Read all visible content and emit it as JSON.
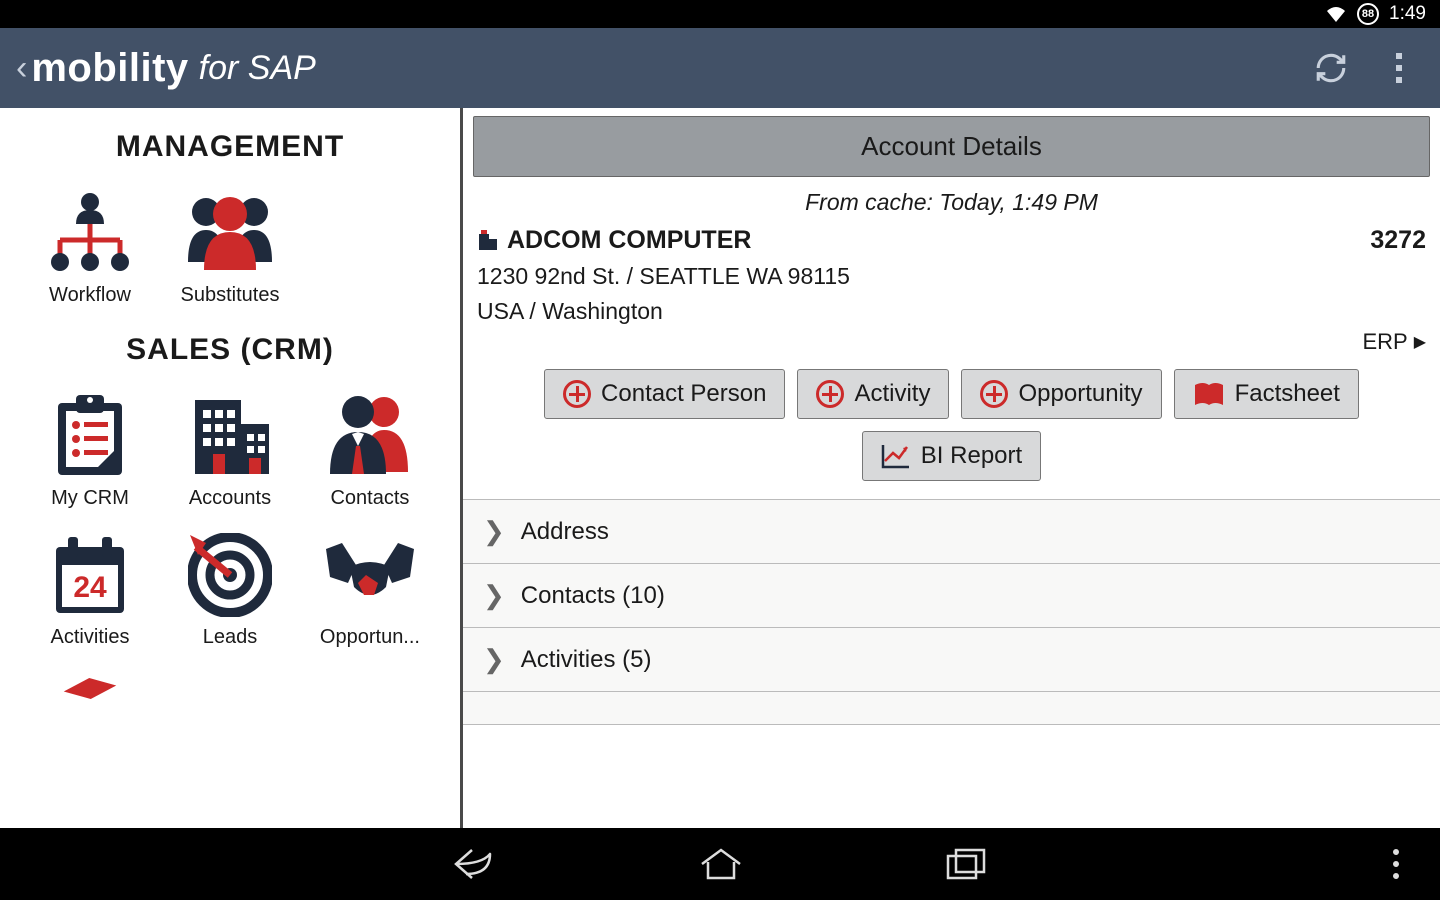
{
  "status": {
    "battery": "88",
    "time": "1:49"
  },
  "appbar": {
    "title_main": "mobility",
    "title_sub": "for SAP"
  },
  "sidebar": {
    "sections": [
      {
        "title": "MANAGEMENT",
        "items": [
          {
            "label": "Workflow"
          },
          {
            "label": "Substitutes"
          }
        ]
      },
      {
        "title": "SALES (CRM)",
        "items": [
          {
            "label": "My CRM"
          },
          {
            "label": "Accounts"
          },
          {
            "label": "Contacts"
          },
          {
            "label": "Activities"
          },
          {
            "label": "Leads"
          },
          {
            "label": "Opportun..."
          }
        ]
      }
    ]
  },
  "detail": {
    "header": "Account Details",
    "cache": "From cache: Today, 1:49 PM",
    "account_name": "ADCOM COMPUTER",
    "account_id": "3272",
    "address_line1": "1230 92nd St. / SEATTLE WA 98115",
    "address_line2": "USA / Washington",
    "erp": "ERP",
    "actions": {
      "contact_person": "Contact Person",
      "activity": "Activity",
      "opportunity": "Opportunity",
      "factsheet": "Factsheet",
      "bi_report": "BI Report"
    },
    "accordion": [
      {
        "label": "Address"
      },
      {
        "label": "Contacts (10)"
      },
      {
        "label": "Activities (5)"
      }
    ]
  }
}
